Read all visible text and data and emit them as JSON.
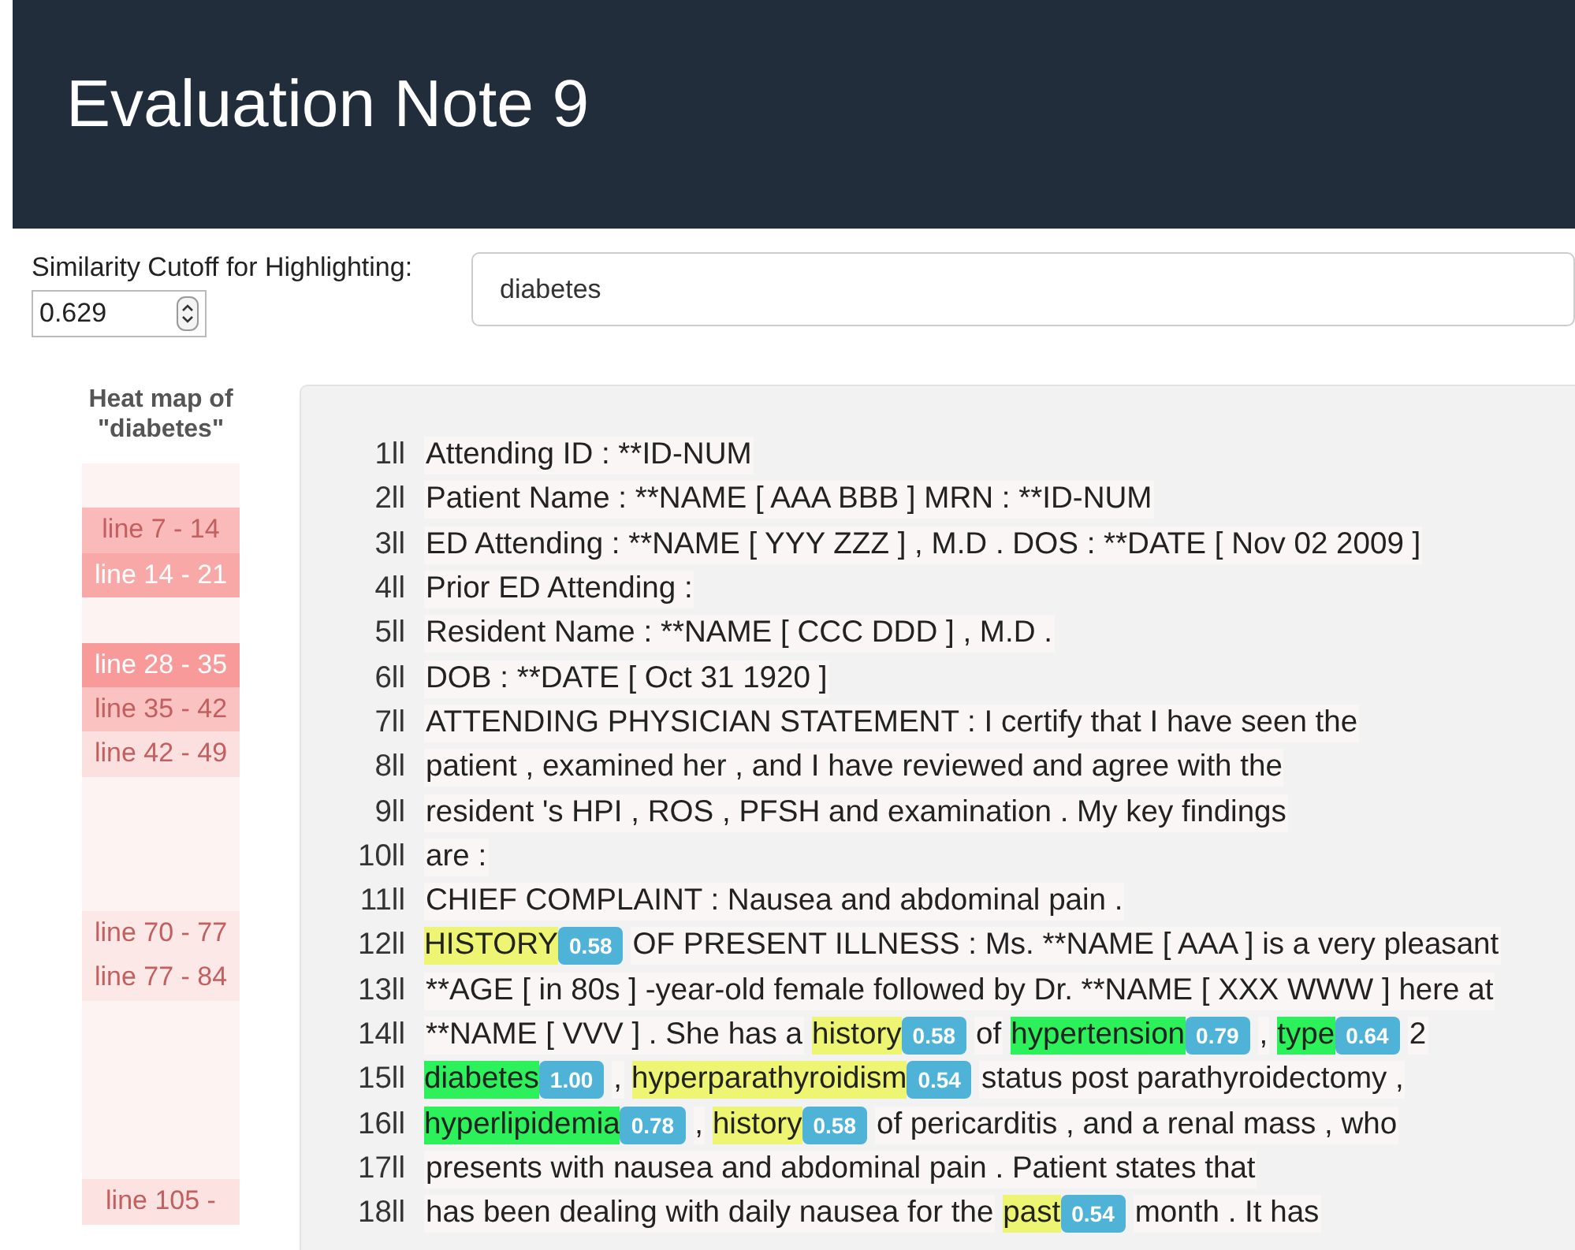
{
  "header": {
    "title": "Evaluation Note 9"
  },
  "cutoff": {
    "label": "Similarity Cutoff for Highlighting:",
    "value": "0.629"
  },
  "search": {
    "value": "diabetes"
  },
  "heatmap": {
    "title": "Heat map of \"diabetes\"",
    "segments": [
      {
        "color": "#fdf3f3"
      },
      {
        "color": "#fbbaba",
        "label": "line 7 - 14"
      },
      {
        "color": "#f9a8a8",
        "label": "line 14 - 21"
      },
      {
        "color": "#fdf3f3"
      },
      {
        "color": "#f89a9a",
        "label": "line 28 - 35"
      },
      {
        "color": "#fbc2c2",
        "label": "line 35 - 42"
      },
      {
        "color": "#fce0e0",
        "label": "line 42 - 49"
      },
      {
        "color": "#fdf3f3"
      },
      {
        "color": "#fdf3f3"
      },
      {
        "color": "#fdf3f3"
      },
      {
        "color": "#fde8e8",
        "label": "line 70 - 77"
      },
      {
        "color": "#fde8e8",
        "label": "line 77 - 84"
      },
      {
        "color": "#fdf3f3"
      },
      {
        "color": "#fdf3f3"
      },
      {
        "color": "#fdf3f3"
      },
      {
        "color": "#fdf3f3"
      },
      {
        "color": "#fde2e2",
        "label": "line 105 -"
      }
    ]
  },
  "note": {
    "lines": [
      {
        "number": "1ll",
        "segments": [
          {
            "kind": "plain",
            "text": "Attending ID : **ID-NUM"
          }
        ]
      },
      {
        "number": "2ll",
        "segments": [
          {
            "kind": "plain",
            "text": "Patient Name : **NAME [ AAA BBB ] MRN : **ID-NUM"
          }
        ]
      },
      {
        "number": "3ll",
        "segments": [
          {
            "kind": "plain",
            "text": "ED Attending : **NAME [ YYY ZZZ ] , M.D . DOS : **DATE [ Nov 02 2009 ]"
          }
        ]
      },
      {
        "number": "4ll",
        "segments": [
          {
            "kind": "plain",
            "text": "Prior ED Attending :"
          }
        ]
      },
      {
        "number": "5ll",
        "segments": [
          {
            "kind": "plain",
            "text": "Resident Name : **NAME [ CCC DDD ] , M.D ."
          }
        ]
      },
      {
        "number": "6ll",
        "segments": [
          {
            "kind": "plain",
            "text": "DOB : **DATE [ Oct 31 1920 ]"
          }
        ]
      },
      {
        "number": "7ll",
        "segments": [
          {
            "kind": "plain",
            "text": "ATTENDING PHYSICIAN STATEMENT : I certify that I have seen the"
          }
        ]
      },
      {
        "number": "8ll",
        "segments": [
          {
            "kind": "plain",
            "text": "patient , examined her , and I have reviewed and agree with the"
          }
        ]
      },
      {
        "number": "9ll",
        "segments": [
          {
            "kind": "plain",
            "text": "resident 's HPI , ROS , PFSH and examination . My key findings"
          }
        ]
      },
      {
        "number": "10ll",
        "segments": [
          {
            "kind": "plain",
            "text": "are :"
          }
        ]
      },
      {
        "number": "11ll",
        "segments": [
          {
            "kind": "plain",
            "text": "CHIEF COMPLAINT : Nausea and abdominal pain ."
          }
        ]
      },
      {
        "number": "12ll",
        "segments": [
          {
            "kind": "weak",
            "text": "HISTORY",
            "score": "0.58"
          },
          {
            "kind": "plain",
            "text": "OF PRESENT ILLNESS : Ms. **NAME [ AAA ] is a very pleasant"
          }
        ]
      },
      {
        "number": "13ll",
        "segments": [
          {
            "kind": "plain",
            "text": "**AGE [ in 80s ] -year-old female followed by Dr. **NAME [ XXX WWW ] here at"
          }
        ]
      },
      {
        "number": "14ll",
        "segments": [
          {
            "kind": "plain",
            "text": "**NAME [ VVV ] . She has a"
          },
          {
            "kind": "weak",
            "text": "history",
            "score": "0.58"
          },
          {
            "kind": "plain",
            "text": "of"
          },
          {
            "kind": "strong",
            "text": "hypertension",
            "score": "0.79"
          },
          {
            "kind": "plain",
            "text": ","
          },
          {
            "kind": "strong",
            "text": "type",
            "score": "0.64"
          },
          {
            "kind": "plain",
            "text": "2"
          }
        ]
      },
      {
        "number": "15ll",
        "segments": [
          {
            "kind": "strong",
            "text": "diabetes",
            "score": "1.00"
          },
          {
            "kind": "plain",
            "text": ","
          },
          {
            "kind": "weak",
            "text": "hyperparathyroidism",
            "score": "0.54"
          },
          {
            "kind": "plain",
            "text": "status post parathyroidectomy ,"
          }
        ]
      },
      {
        "number": "16ll",
        "segments": [
          {
            "kind": "strong",
            "text": "hyperlipidemia",
            "score": "0.78"
          },
          {
            "kind": "plain",
            "text": ","
          },
          {
            "kind": "weak",
            "text": "history",
            "score": "0.58"
          },
          {
            "kind": "plain",
            "text": "of pericarditis , and a renal mass , who"
          }
        ]
      },
      {
        "number": "17ll",
        "segments": [
          {
            "kind": "plain",
            "text": "presents with nausea and abdominal pain . Patient states that"
          }
        ]
      },
      {
        "number": "18ll",
        "segments": [
          {
            "kind": "plain",
            "text": "has been dealing with daily nausea for the"
          },
          {
            "kind": "weak",
            "text": "past",
            "score": "0.54"
          },
          {
            "kind": "plain",
            "text": "month . It has"
          }
        ]
      }
    ]
  }
}
